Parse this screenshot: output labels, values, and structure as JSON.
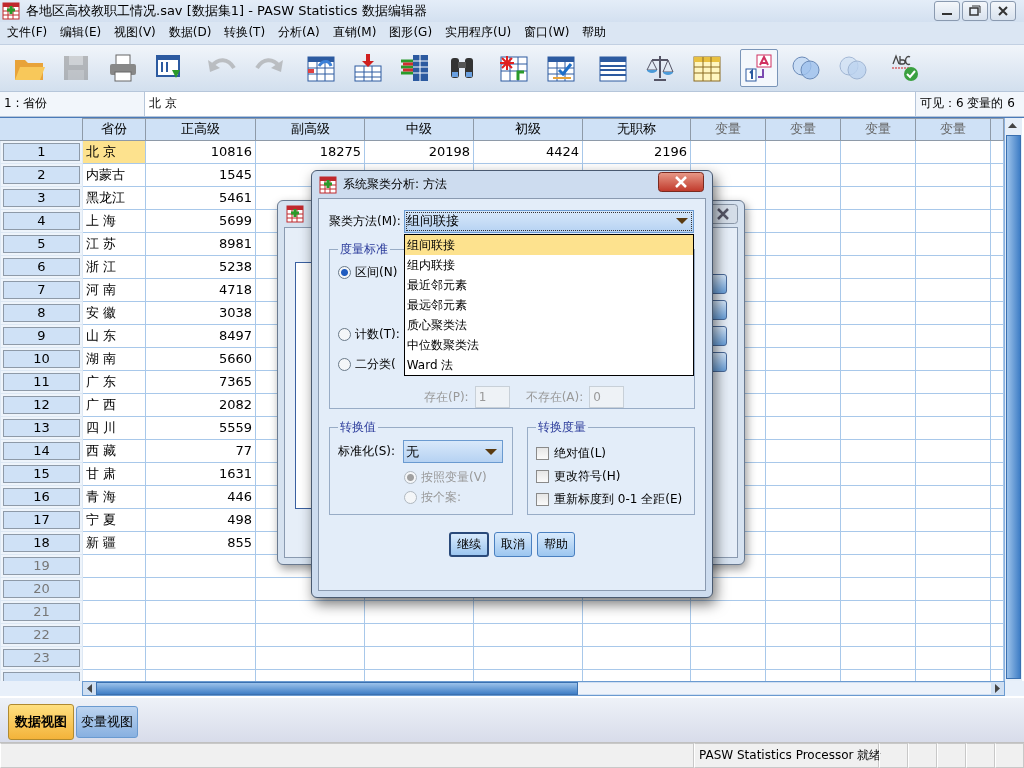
{
  "window": {
    "title": "各地区高校教职工情况.sav [数据集1] - PASW Statistics 数据编辑器"
  },
  "menu": [
    "文件(F)",
    "编辑(E)",
    "视图(V)",
    "数据(D)",
    "转换(T)",
    "分析(A)",
    "直销(M)",
    "图形(G)",
    "实用程序(U)",
    "窗口(W)",
    "帮助"
  ],
  "toolbar": [
    [
      {
        "kind": "open",
        "disabled": false,
        "pressed": false
      },
      {
        "kind": "save",
        "disabled": true,
        "pressed": false
      },
      {
        "kind": "print",
        "disabled": false,
        "pressed": false
      },
      {
        "kind": "recall",
        "disabled": false,
        "pressed": false
      }
    ],
    [
      {
        "kind": "undo",
        "disabled": true,
        "pressed": false
      },
      {
        "kind": "redo",
        "disabled": true,
        "pressed": false
      }
    ],
    [
      {
        "kind": "goto_case",
        "disabled": false,
        "pressed": false
      },
      {
        "kind": "goto_var",
        "disabled": false,
        "pressed": false
      },
      {
        "kind": "variables",
        "disabled": false,
        "pressed": false
      },
      {
        "kind": "find",
        "disabled": false,
        "pressed": false
      }
    ],
    [
      {
        "kind": "insert_case",
        "disabled": false,
        "pressed": false
      },
      {
        "kind": "insert_var",
        "disabled": false,
        "pressed": false
      }
    ],
    [
      {
        "kind": "split",
        "disabled": false,
        "pressed": false
      },
      {
        "kind": "weight",
        "disabled": false,
        "pressed": false
      },
      {
        "kind": "select",
        "disabled": false,
        "pressed": false
      }
    ],
    [
      {
        "kind": "labels",
        "disabled": false,
        "pressed": true
      },
      {
        "kind": "sets",
        "disabled": false,
        "pressed": false
      },
      {
        "kind": "sets",
        "disabled": true,
        "pressed": false
      }
    ],
    [
      {
        "kind": "spell",
        "disabled": false,
        "pressed": false
      }
    ]
  ],
  "cell_editor": {
    "cell": "1 : 省份",
    "value": "北 京",
    "visible": "可见：6 变量的 6"
  },
  "grid": {
    "columns": [
      {
        "label": "省份",
        "placeholder": false
      },
      {
        "label": "正高级",
        "placeholder": false
      },
      {
        "label": "副高级",
        "placeholder": false
      },
      {
        "label": "中级",
        "placeholder": false
      },
      {
        "label": "初级",
        "placeholder": false
      },
      {
        "label": "无职称",
        "placeholder": false
      },
      {
        "label": "变量",
        "placeholder": true
      },
      {
        "label": "变量",
        "placeholder": true
      },
      {
        "label": "变量",
        "placeholder": true
      },
      {
        "label": "变量",
        "placeholder": true
      }
    ],
    "rows": [
      {
        "number": "1",
        "selected": true,
        "cells": [
          "北 京",
          "10816",
          "18275",
          "20198",
          "4424",
          "2196"
        ]
      },
      {
        "number": "2",
        "selected": false,
        "cells": [
          "内蒙古",
          "1545"
        ]
      },
      {
        "number": "3",
        "selected": false,
        "cells": [
          "黑龙江",
          "5461"
        ]
      },
      {
        "number": "4",
        "selected": false,
        "cells": [
          "上 海",
          "5699"
        ]
      },
      {
        "number": "5",
        "selected": false,
        "cells": [
          "江 苏",
          "8981"
        ]
      },
      {
        "number": "6",
        "selected": false,
        "cells": [
          "浙 江",
          "5238"
        ]
      },
      {
        "number": "7",
        "selected": false,
        "cells": [
          "河 南",
          "4718"
        ]
      },
      {
        "number": "8",
        "selected": false,
        "cells": [
          "安 徽",
          "3038"
        ]
      },
      {
        "number": "9",
        "selected": false,
        "cells": [
          "山 东",
          "8497"
        ]
      },
      {
        "number": "10",
        "selected": false,
        "cells": [
          "湖 南",
          "5660"
        ]
      },
      {
        "number": "11",
        "selected": false,
        "cells": [
          "广 东",
          "7365"
        ]
      },
      {
        "number": "12",
        "selected": false,
        "cells": [
          "广 西",
          "2082"
        ]
      },
      {
        "number": "13",
        "selected": false,
        "cells": [
          "四 川",
          "5559"
        ]
      },
      {
        "number": "14",
        "selected": false,
        "cells": [
          "西 藏",
          "77"
        ]
      },
      {
        "number": "15",
        "selected": false,
        "cells": [
          "甘 肃",
          "1631"
        ]
      },
      {
        "number": "16",
        "selected": false,
        "cells": [
          "青 海",
          "446"
        ]
      },
      {
        "number": "17",
        "selected": false,
        "cells": [
          "宁 夏",
          "498"
        ]
      },
      {
        "number": "18",
        "selected": false,
        "cells": [
          "新 疆",
          "855"
        ]
      },
      {
        "number": "19",
        "selected": false
      },
      {
        "number": "20",
        "selected": false
      },
      {
        "number": "21",
        "selected": false
      },
      {
        "number": "22",
        "selected": false
      },
      {
        "number": "23",
        "selected": false
      }
    ]
  },
  "dialog": {
    "title": "系统聚类分析: 方法",
    "method_label": "聚类方法(M):",
    "method_value": "组间联接",
    "method_options": [
      {
        "label": "组间联接",
        "selected": true
      },
      {
        "label": "组内联接",
        "selected": false
      },
      {
        "label": "最近邻元素",
        "selected": false
      },
      {
        "label": "最远邻元素",
        "selected": false
      },
      {
        "label": "质心聚类法",
        "selected": false
      },
      {
        "label": "中位数聚类法",
        "selected": false
      },
      {
        "label": "Ward 法",
        "selected": false
      }
    ],
    "measure": {
      "title": "度量标准",
      "options": [
        {
          "label": "区间(N)",
          "selected": true
        },
        {
          "label": "计数(T):",
          "selected": false
        },
        {
          "label": "二分类(",
          "selected": false
        }
      ],
      "present": {
        "label": "存在(P):",
        "value": "1",
        "disabled": true
      },
      "absent": {
        "label": "不存在(A):",
        "value": "0",
        "disabled": true
      }
    },
    "transform_values": {
      "title": "转换值",
      "standardize_label": "标准化(S):",
      "standardize_value": "无",
      "options": [
        {
          "label": "按照变量(V)",
          "selected": true,
          "disabled": true
        },
        {
          "label": "按个案:",
          "selected": false,
          "disabled": true
        }
      ]
    },
    "transform_measures": {
      "title": "转换度量",
      "options": [
        {
          "label": "绝对值(L)",
          "checked": false
        },
        {
          "label": "更改符号(H)",
          "checked": false
        },
        {
          "label": "重新标度到 0-1 全距(E)",
          "checked": false
        }
      ]
    },
    "buttons": [
      {
        "label": "继续",
        "default": true
      },
      {
        "label": "取消",
        "default": false
      },
      {
        "label": "帮助",
        "default": false
      }
    ]
  },
  "tabs": [
    {
      "label": "数据视图",
      "selected": true
    },
    {
      "label": "变量视图",
      "selected": false
    }
  ],
  "status_bar": {
    "message": "PASW Statistics Processor 就绪"
  }
}
